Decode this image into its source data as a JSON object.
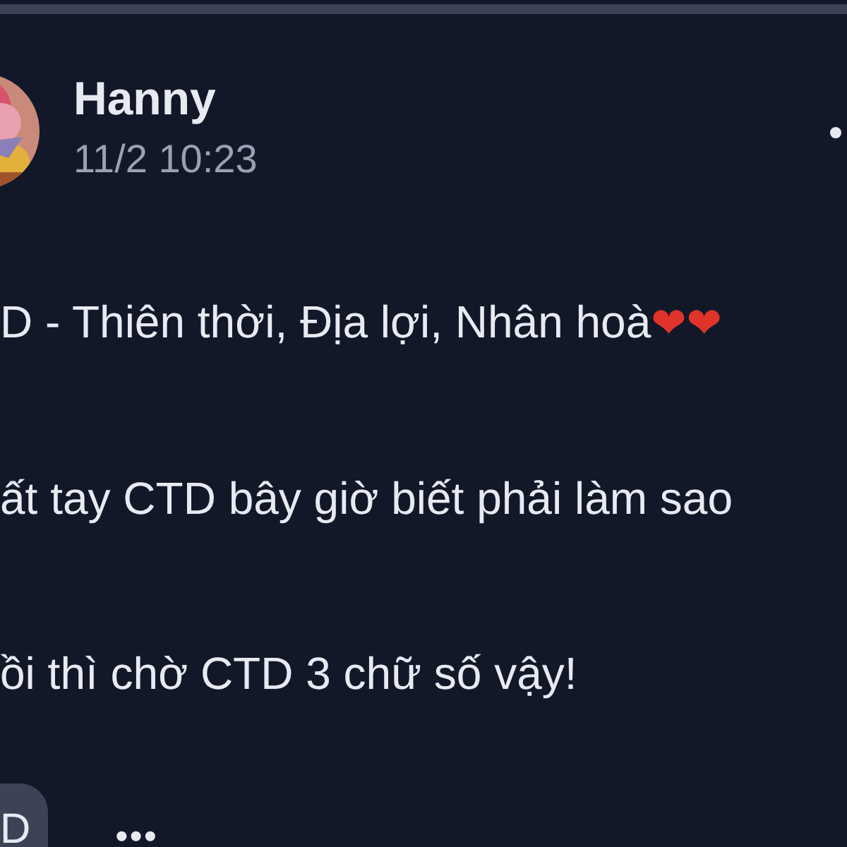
{
  "post": {
    "author": "Hanny",
    "time": "11/2 10:23",
    "lines": [
      {
        "text": "D - Thiên thời, Địa lợi, Nhân hoà",
        "emoji": "❤❤"
      },
      {
        "text": "ất tay CTD bây giờ biết phải làm sao"
      },
      {
        "text": "ồi thì chờ CTD 3 chữ số vậy!"
      }
    ],
    "tag": "D",
    "more": "•••"
  }
}
